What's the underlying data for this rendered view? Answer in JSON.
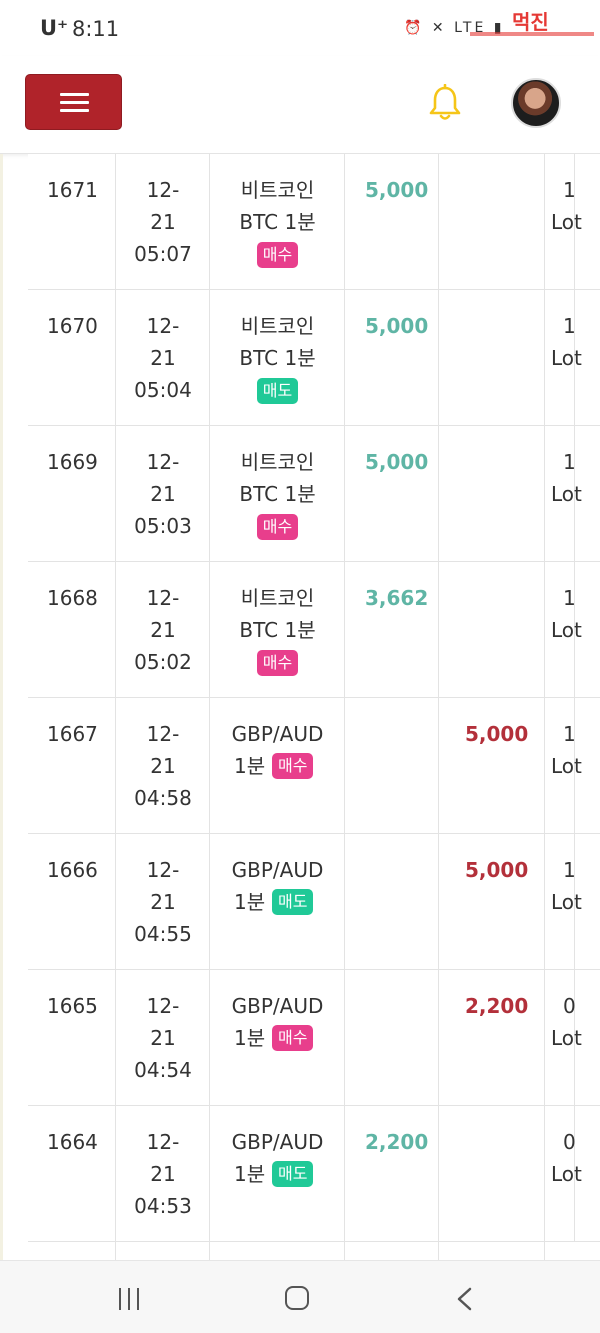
{
  "status_bar": {
    "carrier": "U⁺",
    "time": "8:11",
    "icons": [
      "alarm-icon",
      "mute-icon",
      "lte-icon",
      "signal-icon",
      "battery-icon"
    ],
    "icons_text": "⏰ ✕ LTE ▮",
    "watermark_text": "먹진"
  },
  "header": {
    "menu_icon": "hamburger-icon",
    "bell_icon": "bell-icon",
    "avatar_icon": "user-avatar"
  },
  "trades": [
    {
      "id": "1671",
      "date_line1": "12-",
      "date_line2": "21",
      "time": "05:07",
      "item_line1": "비트코인",
      "item_line2": "BTC 1분",
      "side": "매수",
      "side_type": "buy",
      "buy_amount": "5,000",
      "sell_amount": "",
      "lot_line1": "1",
      "lot_line2": "Lot"
    },
    {
      "id": "1670",
      "date_line1": "12-",
      "date_line2": "21",
      "time": "05:04",
      "item_line1": "비트코인",
      "item_line2": "BTC 1분",
      "side": "매도",
      "side_type": "sell",
      "buy_amount": "5,000",
      "sell_amount": "",
      "lot_line1": "1",
      "lot_line2": "Lot"
    },
    {
      "id": "1669",
      "date_line1": "12-",
      "date_line2": "21",
      "time": "05:03",
      "item_line1": "비트코인",
      "item_line2": "BTC 1분",
      "side": "매수",
      "side_type": "buy",
      "buy_amount": "5,000",
      "sell_amount": "",
      "lot_line1": "1",
      "lot_line2": "Lot"
    },
    {
      "id": "1668",
      "date_line1": "12-",
      "date_line2": "21",
      "time": "05:02",
      "item_line1": "비트코인",
      "item_line2": "BTC 1분",
      "side": "매수",
      "side_type": "buy",
      "buy_amount": "3,662",
      "sell_amount": "",
      "lot_line1": "1",
      "lot_line2": "Lot"
    },
    {
      "id": "1667",
      "date_line1": "12-",
      "date_line2": "21",
      "time": "04:58",
      "item_line1": "GBP/AUD",
      "item_line2": "1분",
      "side": "매수",
      "side_type": "buy",
      "buy_amount": "",
      "sell_amount": "5,000",
      "lot_line1": "1",
      "lot_line2": "Lot"
    },
    {
      "id": "1666",
      "date_line1": "12-",
      "date_line2": "21",
      "time": "04:55",
      "item_line1": "GBP/AUD",
      "item_line2": "1분",
      "side": "매도",
      "side_type": "sell",
      "buy_amount": "",
      "sell_amount": "5,000",
      "lot_line1": "1",
      "lot_line2": "Lot"
    },
    {
      "id": "1665",
      "date_line1": "12-",
      "date_line2": "21",
      "time": "04:54",
      "item_line1": "GBP/AUD",
      "item_line2": "1분",
      "side": "매수",
      "side_type": "buy",
      "buy_amount": "",
      "sell_amount": "2,200",
      "lot_line1": "0",
      "lot_line2": "Lot"
    },
    {
      "id": "1664",
      "date_line1": "12-",
      "date_line2": "21",
      "time": "04:53",
      "item_line1": "GBP/AUD",
      "item_line2": "1분",
      "side": "매도",
      "side_type": "sell",
      "buy_amount": "2,200",
      "sell_amount": "",
      "lot_line1": "0",
      "lot_line2": "Lot"
    }
  ],
  "colors": {
    "menu_button": "#b0232a",
    "bell": "#f5c518",
    "buy_badge": "#e83e8c",
    "sell_badge": "#20c997",
    "profit_amount": "#5fb5a5",
    "loss_amount": "#b3303a"
  },
  "nav_bar": {
    "recent_icon": "recent-apps-icon",
    "home_icon": "home-icon",
    "back_icon": "back-icon"
  }
}
